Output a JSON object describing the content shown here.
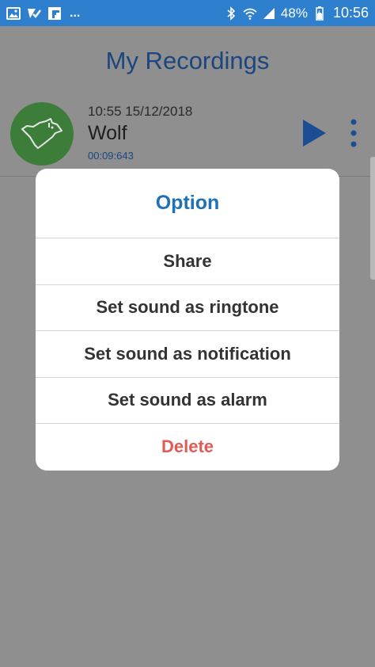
{
  "status_bar": {
    "left_more": "...",
    "battery_percent": "48%",
    "time": "10:56"
  },
  "header": {
    "title": "My Recordings"
  },
  "recording": {
    "datetime": "10:55 15/12/2018",
    "name": "Wolf",
    "duration": "00:09:643",
    "avatar_icon": "wolf-icon",
    "avatar_color": "#3c7d3a"
  },
  "dialog": {
    "title": "Option",
    "options": [
      {
        "label": "Share"
      },
      {
        "label": "Set sound as ringtone"
      },
      {
        "label": "Set sound as notification"
      },
      {
        "label": "Set sound as alarm"
      },
      {
        "label": "Delete"
      }
    ]
  },
  "colors": {
    "status_bar": "#2f7fcf",
    "accent": "#1f6fb9",
    "danger": "#e25b55",
    "overlay": "#8f8f8f"
  }
}
